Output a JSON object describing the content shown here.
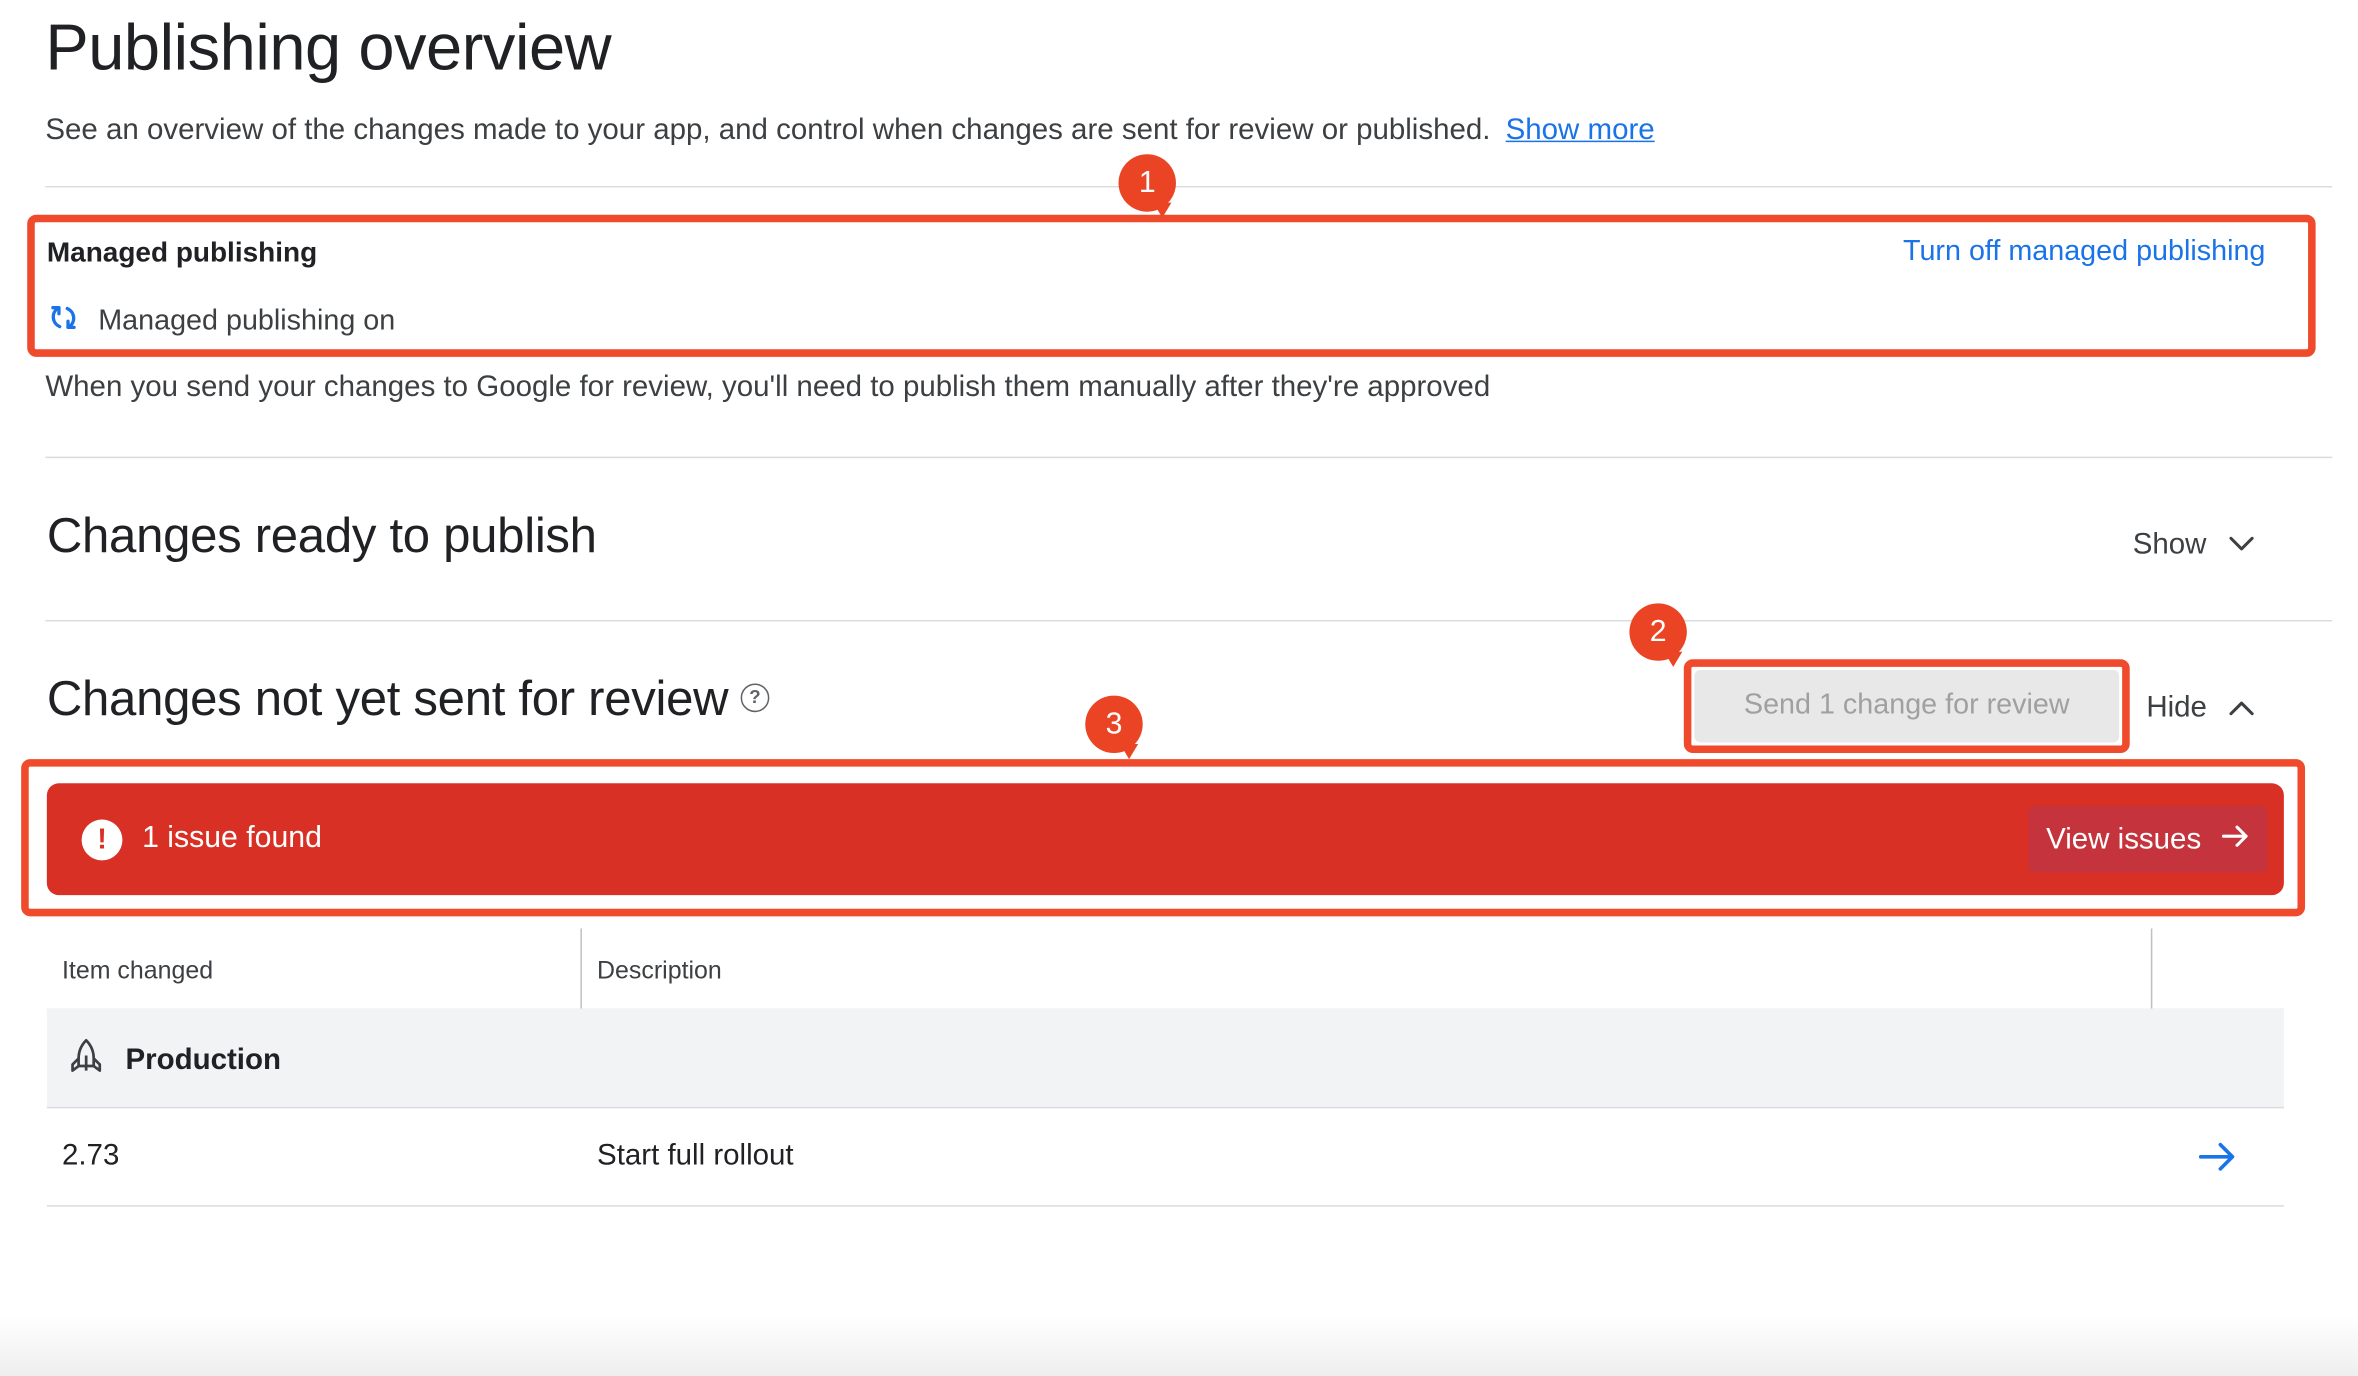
{
  "header": {
    "title": "Publishing overview",
    "description": "See an overview of the changes made to your app, and control when changes are sent for review or published.",
    "show_more": "Show more"
  },
  "managed_publishing": {
    "title": "Managed publishing",
    "toggle_link": "Turn off managed publishing",
    "status": "Managed publishing on",
    "description": "When you send your changes to Google for review, you'll need to publish them manually after they're approved"
  },
  "ready_section": {
    "title": "Changes ready to publish",
    "toggle_label": "Show"
  },
  "not_sent_section": {
    "title": "Changes not yet sent for review",
    "send_button": "Send 1 change for review",
    "toggle_label": "Hide"
  },
  "issues": {
    "text": "1 issue found",
    "view_button": "View issues"
  },
  "table": {
    "headers": [
      "Item changed",
      "Description"
    ],
    "group": "Production",
    "rows": [
      {
        "item": "2.73",
        "description": "Start full rollout"
      }
    ]
  },
  "annotations": {
    "badges": [
      "1",
      "2",
      "3"
    ],
    "color": "#f04a2d"
  },
  "colors": {
    "link": "#1a73e8",
    "error": "#d93025",
    "annotation": "#f04a2d"
  }
}
